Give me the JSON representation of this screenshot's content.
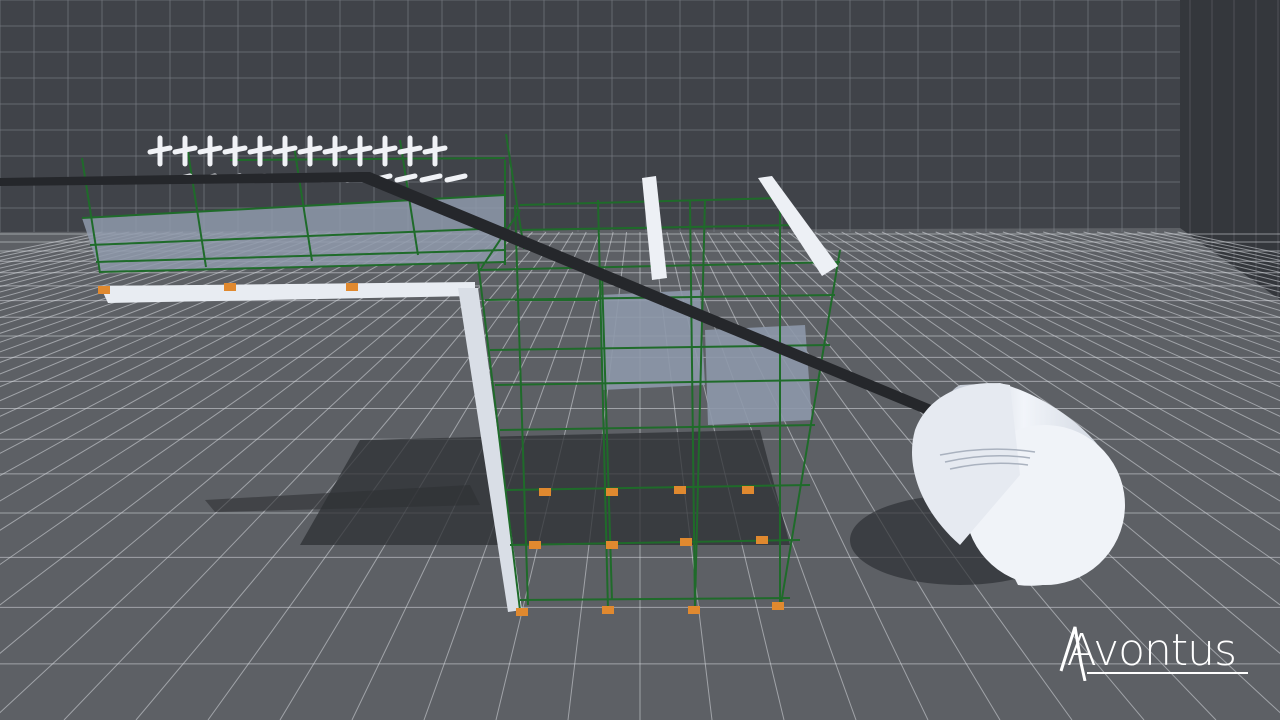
{
  "brand": {
    "logo_text": "Avontus"
  },
  "scene": {
    "background_color": "#4a4d52",
    "wall_color": "#3f4247",
    "floor_color": "#5f6266",
    "grid_color": "#d8dbe0",
    "scaffold_color": "#1f6b2a",
    "beam_color": "#e8ecf2",
    "tank_color": "#eef1f6",
    "pipe_color": "#2a2c30",
    "deck_color": "#98a4b6",
    "base_plate_color": "#e0892f"
  }
}
